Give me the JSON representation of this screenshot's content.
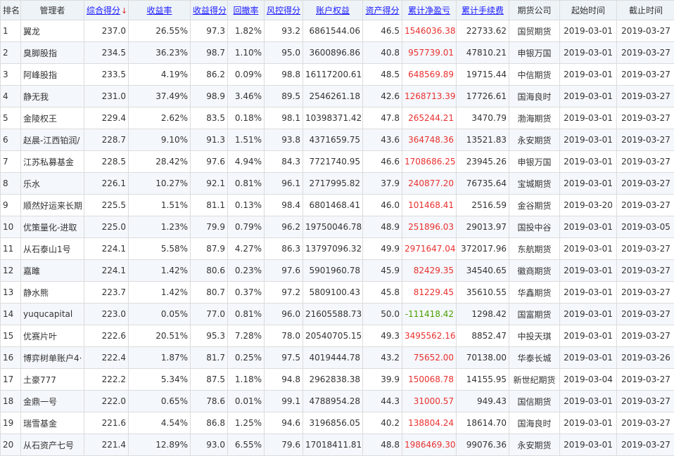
{
  "header": {
    "rank": "排名",
    "manager": "管理者",
    "composite_score": "综合得分",
    "sort_arrow": "↓",
    "return_rate": "收益率",
    "return_score": "收益得分",
    "drawdown": "回撤率",
    "risk_score": "风控得分",
    "equity": "账户权益",
    "asset_score": "资产得分",
    "net_pnl": "累计净盈亏",
    "fees": "累计手续费",
    "broker": "期货公司",
    "start_date": "起始时间",
    "end_date": "截止时间"
  },
  "colors": {
    "positive": "#e8312f",
    "negative": "#4aa000",
    "link": "#1a1aff"
  },
  "rows": [
    {
      "rank": "1",
      "manager": "翼龙",
      "composite": "237.0",
      "return": "26.55%",
      "return_score": "97.3",
      "drawdown": "1.82%",
      "risk_score": "93.2",
      "equity": "6861544.06",
      "asset_score": "46.5",
      "pnl": "1546036.38",
      "pnl_sign": "pos",
      "fees": "22733.62",
      "broker": "国贸期货",
      "start": "2019-03-01",
      "end": "2019-03-27"
    },
    {
      "rank": "2",
      "manager": "臭脚股指",
      "composite": "234.5",
      "return": "36.23%",
      "return_score": "98.7",
      "drawdown": "1.10%",
      "risk_score": "95.0",
      "equity": "3600896.86",
      "asset_score": "40.8",
      "pnl": "957739.01",
      "pnl_sign": "pos",
      "fees": "47810.21",
      "broker": "申银万国",
      "start": "2019-03-01",
      "end": "2019-03-27"
    },
    {
      "rank": "3",
      "manager": "阿峰股指",
      "composite": "233.5",
      "return": "4.19%",
      "return_score": "86.2",
      "drawdown": "0.09%",
      "risk_score": "98.8",
      "equity": "16117200.61",
      "asset_score": "48.5",
      "pnl": "648569.89",
      "pnl_sign": "pos",
      "fees": "19715.44",
      "broker": "中信期货",
      "start": "2019-03-01",
      "end": "2019-03-27"
    },
    {
      "rank": "4",
      "manager": "静无我",
      "composite": "231.0",
      "return": "37.49%",
      "return_score": "98.9",
      "drawdown": "3.46%",
      "risk_score": "89.5",
      "equity": "2546261.18",
      "asset_score": "42.6",
      "pnl": "1268713.39",
      "pnl_sign": "pos",
      "fees": "17726.61",
      "broker": "国海良时",
      "start": "2019-03-01",
      "end": "2019-03-27"
    },
    {
      "rank": "5",
      "manager": "金陵权王",
      "composite": "229.4",
      "return": "2.62%",
      "return_score": "83.5",
      "drawdown": "0.18%",
      "risk_score": "98.1",
      "equity": "10398371.42",
      "asset_score": "47.8",
      "pnl": "265244.21",
      "pnl_sign": "pos",
      "fees": "3470.79",
      "broker": "渤海期货",
      "start": "2019-03-01",
      "end": "2019-03-27"
    },
    {
      "rank": "6",
      "manager": "赵晨-江西铂润/",
      "composite": "228.7",
      "return": "9.10%",
      "return_score": "91.3",
      "drawdown": "1.51%",
      "risk_score": "93.8",
      "equity": "4371659.75",
      "asset_score": "43.6",
      "pnl": "364748.36",
      "pnl_sign": "pos",
      "fees": "13521.83",
      "broker": "永安期货",
      "start": "2019-03-01",
      "end": "2019-03-27"
    },
    {
      "rank": "7",
      "manager": "江苏私募基金",
      "composite": "228.5",
      "return": "28.42%",
      "return_score": "97.6",
      "drawdown": "4.94%",
      "risk_score": "84.3",
      "equity": "7721740.95",
      "asset_score": "46.6",
      "pnl": "1708686.25",
      "pnl_sign": "pos",
      "fees": "23945.26",
      "broker": "申银万国",
      "start": "2019-03-01",
      "end": "2019-03-27"
    },
    {
      "rank": "8",
      "manager": "乐水",
      "composite": "226.1",
      "return": "10.27%",
      "return_score": "92.1",
      "drawdown": "0.81%",
      "risk_score": "96.1",
      "equity": "2717995.82",
      "asset_score": "37.9",
      "pnl": "240877.20",
      "pnl_sign": "pos",
      "fees": "76735.64",
      "broker": "宝城期货",
      "start": "2019-03-01",
      "end": "2019-03-27"
    },
    {
      "rank": "9",
      "manager": "顺然好运来长期",
      "composite": "225.5",
      "return": "1.51%",
      "return_score": "81.1",
      "drawdown": "0.13%",
      "risk_score": "98.4",
      "equity": "6801468.41",
      "asset_score": "46.0",
      "pnl": "101468.41",
      "pnl_sign": "pos",
      "fees": "2516.59",
      "broker": "金谷期货",
      "start": "2019-03-20",
      "end": "2019-03-27"
    },
    {
      "rank": "10",
      "manager": "优策量化-进取",
      "composite": "225.0",
      "return": "1.23%",
      "return_score": "79.9",
      "drawdown": "0.79%",
      "risk_score": "96.2",
      "equity": "19750046.78",
      "asset_score": "48.9",
      "pnl": "251896.03",
      "pnl_sign": "pos",
      "fees": "29013.97",
      "broker": "国投中谷",
      "start": "2019-03-01",
      "end": "2019-03-05"
    },
    {
      "rank": "11",
      "manager": "从石泰山1号",
      "composite": "224.1",
      "return": "5.58%",
      "return_score": "87.9",
      "drawdown": "4.27%",
      "risk_score": "86.3",
      "equity": "13797096.32",
      "asset_score": "49.9",
      "pnl": "2971647.04",
      "pnl_sign": "pos",
      "fees": "372017.96",
      "broker": "东航期货",
      "start": "2019-03-01",
      "end": "2019-03-27"
    },
    {
      "rank": "12",
      "manager": "嘉雎",
      "composite": "224.1",
      "return": "1.42%",
      "return_score": "80.6",
      "drawdown": "0.23%",
      "risk_score": "97.6",
      "equity": "5901960.78",
      "asset_score": "45.9",
      "pnl": "82429.35",
      "pnl_sign": "pos",
      "fees": "34540.65",
      "broker": "徽商期货",
      "start": "2019-03-01",
      "end": "2019-03-27"
    },
    {
      "rank": "13",
      "manager": "静水熊",
      "composite": "223.7",
      "return": "1.42%",
      "return_score": "80.7",
      "drawdown": "0.37%",
      "risk_score": "97.2",
      "equity": "5809100.43",
      "asset_score": "45.8",
      "pnl": "81229.45",
      "pnl_sign": "pos",
      "fees": "35610.55",
      "broker": "华鑫期货",
      "start": "2019-03-01",
      "end": "2019-03-27"
    },
    {
      "rank": "14",
      "manager": "yuqucapital",
      "composite": "223.0",
      "return": "0.05%",
      "return_score": "77.0",
      "drawdown": "0.81%",
      "risk_score": "96.0",
      "equity": "21605588.73",
      "asset_score": "50.0",
      "pnl": "-111418.42",
      "pnl_sign": "neg",
      "fees": "1298.42",
      "broker": "国富期货",
      "start": "2019-03-01",
      "end": "2019-03-27"
    },
    {
      "rank": "15",
      "manager": "优赛片叶",
      "composite": "222.6",
      "return": "20.51%",
      "return_score": "95.3",
      "drawdown": "7.28%",
      "risk_score": "78.0",
      "equity": "20540705.15",
      "asset_score": "49.3",
      "pnl": "3495562.16",
      "pnl_sign": "pos",
      "fees": "8852.47",
      "broker": "中投天琪",
      "start": "2019-03-01",
      "end": "2019-03-27"
    },
    {
      "rank": "16",
      "manager": "博弈树单账户4·",
      "composite": "222.4",
      "return": "1.87%",
      "return_score": "81.7",
      "drawdown": "0.25%",
      "risk_score": "97.5",
      "equity": "4019444.78",
      "asset_score": "43.2",
      "pnl": "75652.00",
      "pnl_sign": "pos",
      "fees": "70138.00",
      "broker": "华泰长城",
      "start": "2019-03-01",
      "end": "2019-03-26"
    },
    {
      "rank": "17",
      "manager": "土豪777",
      "composite": "222.2",
      "return": "5.34%",
      "return_score": "87.5",
      "drawdown": "1.18%",
      "risk_score": "94.8",
      "equity": "2962838.38",
      "asset_score": "39.9",
      "pnl": "150068.78",
      "pnl_sign": "pos",
      "fees": "14155.95",
      "broker": "新世纪期货",
      "start": "2019-03-04",
      "end": "2019-03-27"
    },
    {
      "rank": "18",
      "manager": "金鼎一号",
      "composite": "222.0",
      "return": "0.65%",
      "return_score": "78.6",
      "drawdown": "0.01%",
      "risk_score": "99.1",
      "equity": "4788954.28",
      "asset_score": "44.3",
      "pnl": "31000.57",
      "pnl_sign": "pos",
      "fees": "949.43",
      "broker": "国信期货",
      "start": "2019-03-01",
      "end": "2019-03-27"
    },
    {
      "rank": "19",
      "manager": "瑞雪基金",
      "composite": "221.6",
      "return": "4.54%",
      "return_score": "86.8",
      "drawdown": "1.25%",
      "risk_score": "94.6",
      "equity": "3196856.05",
      "asset_score": "40.2",
      "pnl": "138804.24",
      "pnl_sign": "pos",
      "fees": "18614.70",
      "broker": "国海良时",
      "start": "2019-03-01",
      "end": "2019-03-27"
    },
    {
      "rank": "20",
      "manager": "从石资产七号",
      "composite": "221.4",
      "return": "12.89%",
      "return_score": "93.0",
      "drawdown": "6.55%",
      "risk_score": "79.6",
      "equity": "17018411.81",
      "asset_score": "48.8",
      "pnl": "1986469.30",
      "pnl_sign": "pos",
      "fees": "99076.36",
      "broker": "永安期货",
      "start": "2019-03-01",
      "end": "2019-03-27"
    }
  ]
}
